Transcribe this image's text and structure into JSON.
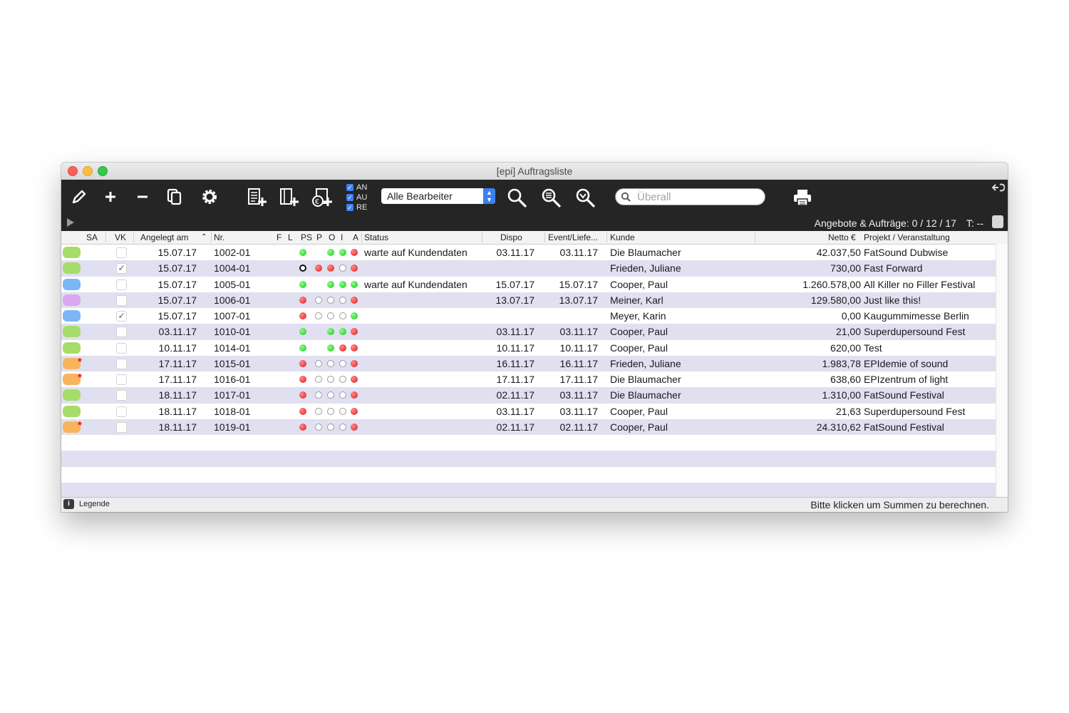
{
  "window": {
    "title": "[epi] Auftragsliste"
  },
  "toolbar": {
    "icons": [
      "pencil-icon",
      "plus-icon",
      "minus-icon",
      "copy-icon",
      "gear-icon",
      "new-offer-icon",
      "new-order-icon",
      "new-invoice-icon",
      "search-icon",
      "zoom-list-icon",
      "zoom-filter-icon",
      "print-icon",
      "sync-icon"
    ],
    "filters": [
      {
        "label": "AN",
        "checked": true
      },
      {
        "label": "AU",
        "checked": true
      },
      {
        "label": "RE",
        "checked": true
      }
    ],
    "editor_select": "Alle Bearbeiter",
    "search_placeholder": "Überall",
    "summary": "Angebote & Aufträge: 0 / 12 / 17",
    "t_label": "T: --"
  },
  "columns": {
    "sa": "SA",
    "vk": "VK",
    "angelegt": "Angelegt am",
    "nr": "Nr.",
    "f": "F",
    "l": "L",
    "ps": "PS",
    "p": "P",
    "o": "O",
    "i": "I",
    "a": "A",
    "status": "Status",
    "dispo": "Dispo",
    "event": "Event/Liefe...",
    "kunde": "Kunde",
    "netto": "Netto €",
    "projekt": "Projekt / Veranstaltung"
  },
  "colors": {
    "green": "#a6dd6a",
    "blue": "#7cb6f5",
    "purple": "#d9a8ee",
    "orange": "#f8b45c",
    "dot_green": "#22cc22",
    "dot_red": "#e51616"
  },
  "rows": [
    {
      "sa": "green",
      "star": false,
      "vk": false,
      "date": "15.07.17",
      "nr": "1002-01",
      "dots": [
        "g",
        "",
        "g",
        "g",
        "r"
      ],
      "status": "warte auf Kundendaten",
      "dispo": "03.11.17",
      "event": "03.11.17",
      "kunde": "Die Blaumacher",
      "netto": "42.037,50",
      "projekt": "FatSound Dubwise"
    },
    {
      "sa": "green",
      "star": false,
      "vk": true,
      "date": "15.07.17",
      "nr": "1004-01",
      "dots": [
        "k",
        "r",
        "r",
        "e",
        "r"
      ],
      "status": "",
      "dispo": "",
      "event": "",
      "kunde": "Frieden, Juliane",
      "netto": "730,00",
      "projekt": "Fast Forward"
    },
    {
      "sa": "blue",
      "star": false,
      "vk": false,
      "date": "15.07.17",
      "nr": "1005-01",
      "dots": [
        "g",
        "",
        "g",
        "g",
        "g"
      ],
      "status": "warte auf Kundendaten",
      "dispo": "15.07.17",
      "event": "15.07.17",
      "kunde": "Cooper, Paul",
      "netto": "1.260.578,00",
      "projekt": "All Killer no Filler Festival"
    },
    {
      "sa": "purple",
      "star": false,
      "vk": false,
      "date": "15.07.17",
      "nr": "1006-01",
      "dots": [
        "r",
        "e",
        "e",
        "e",
        "r"
      ],
      "status": "",
      "dispo": "13.07.17",
      "event": "13.07.17",
      "kunde": "Meiner, Karl",
      "netto": "129.580,00",
      "projekt": "Just like this!"
    },
    {
      "sa": "blue",
      "star": false,
      "vk": true,
      "date": "15.07.17",
      "nr": "1007-01",
      "dots": [
        "r",
        "e",
        "e",
        "e",
        "g"
      ],
      "status": "",
      "dispo": "",
      "event": "",
      "kunde": "Meyer, Karin",
      "netto": "0,00",
      "projekt": "Kaugummimesse Berlin"
    },
    {
      "sa": "green",
      "star": false,
      "vk": false,
      "date": "03.11.17",
      "nr": "1010-01",
      "dots": [
        "g",
        "",
        "g",
        "g",
        "r"
      ],
      "status": "",
      "dispo": "03.11.17",
      "event": "03.11.17",
      "kunde": "Cooper, Paul",
      "netto": "21,00",
      "projekt": "Superdupersound Fest"
    },
    {
      "sa": "green",
      "star": false,
      "vk": false,
      "date": "10.11.17",
      "nr": "1014-01",
      "dots": [
        "g",
        "",
        "g",
        "r",
        "r"
      ],
      "status": "",
      "dispo": "10.11.17",
      "event": "10.11.17",
      "kunde": "Cooper, Paul",
      "netto": "620,00",
      "projekt": "Test"
    },
    {
      "sa": "orange",
      "star": true,
      "vk": false,
      "date": "17.11.17",
      "nr": "1015-01",
      "dots": [
        "r",
        "e",
        "e",
        "e",
        "r"
      ],
      "status": "",
      "dispo": "16.11.17",
      "event": "16.11.17",
      "kunde": "Frieden, Juliane",
      "netto": "1.983,78",
      "projekt": "EPIdemie of sound"
    },
    {
      "sa": "orange",
      "star": true,
      "vk": false,
      "date": "17.11.17",
      "nr": "1016-01",
      "dots": [
        "r",
        "e",
        "e",
        "e",
        "r"
      ],
      "status": "",
      "dispo": "17.11.17",
      "event": "17.11.17",
      "kunde": "Die Blaumacher",
      "netto": "638,60",
      "projekt": "EPIzentrum of light"
    },
    {
      "sa": "green",
      "star": false,
      "vk": false,
      "date": "18.11.17",
      "nr": "1017-01",
      "dots": [
        "r",
        "e",
        "e",
        "e",
        "r"
      ],
      "status": "",
      "dispo": "02.11.17",
      "event": "03.11.17",
      "kunde": "Die Blaumacher",
      "netto": "1.310,00",
      "projekt": "FatSound Festival"
    },
    {
      "sa": "green",
      "star": false,
      "vk": false,
      "date": "18.11.17",
      "nr": "1018-01",
      "dots": [
        "r",
        "e",
        "e",
        "e",
        "r"
      ],
      "status": "",
      "dispo": "03.11.17",
      "event": "03.11.17",
      "kunde": "Cooper, Paul",
      "netto": "21,63",
      "projekt": "Superdupersound Fest"
    },
    {
      "sa": "orange",
      "star": true,
      "vk": false,
      "date": "18.11.17",
      "nr": "1019-01",
      "dots": [
        "r",
        "e",
        "e",
        "e",
        "r"
      ],
      "status": "",
      "dispo": "02.11.17",
      "event": "02.11.17",
      "kunde": "Cooper, Paul",
      "netto": "24.310,62",
      "projekt": "FatSound Festival"
    }
  ],
  "empty_rows": 4,
  "footer": {
    "legend": "Legende",
    "message": "Bitte klicken um Summen zu berechnen."
  }
}
